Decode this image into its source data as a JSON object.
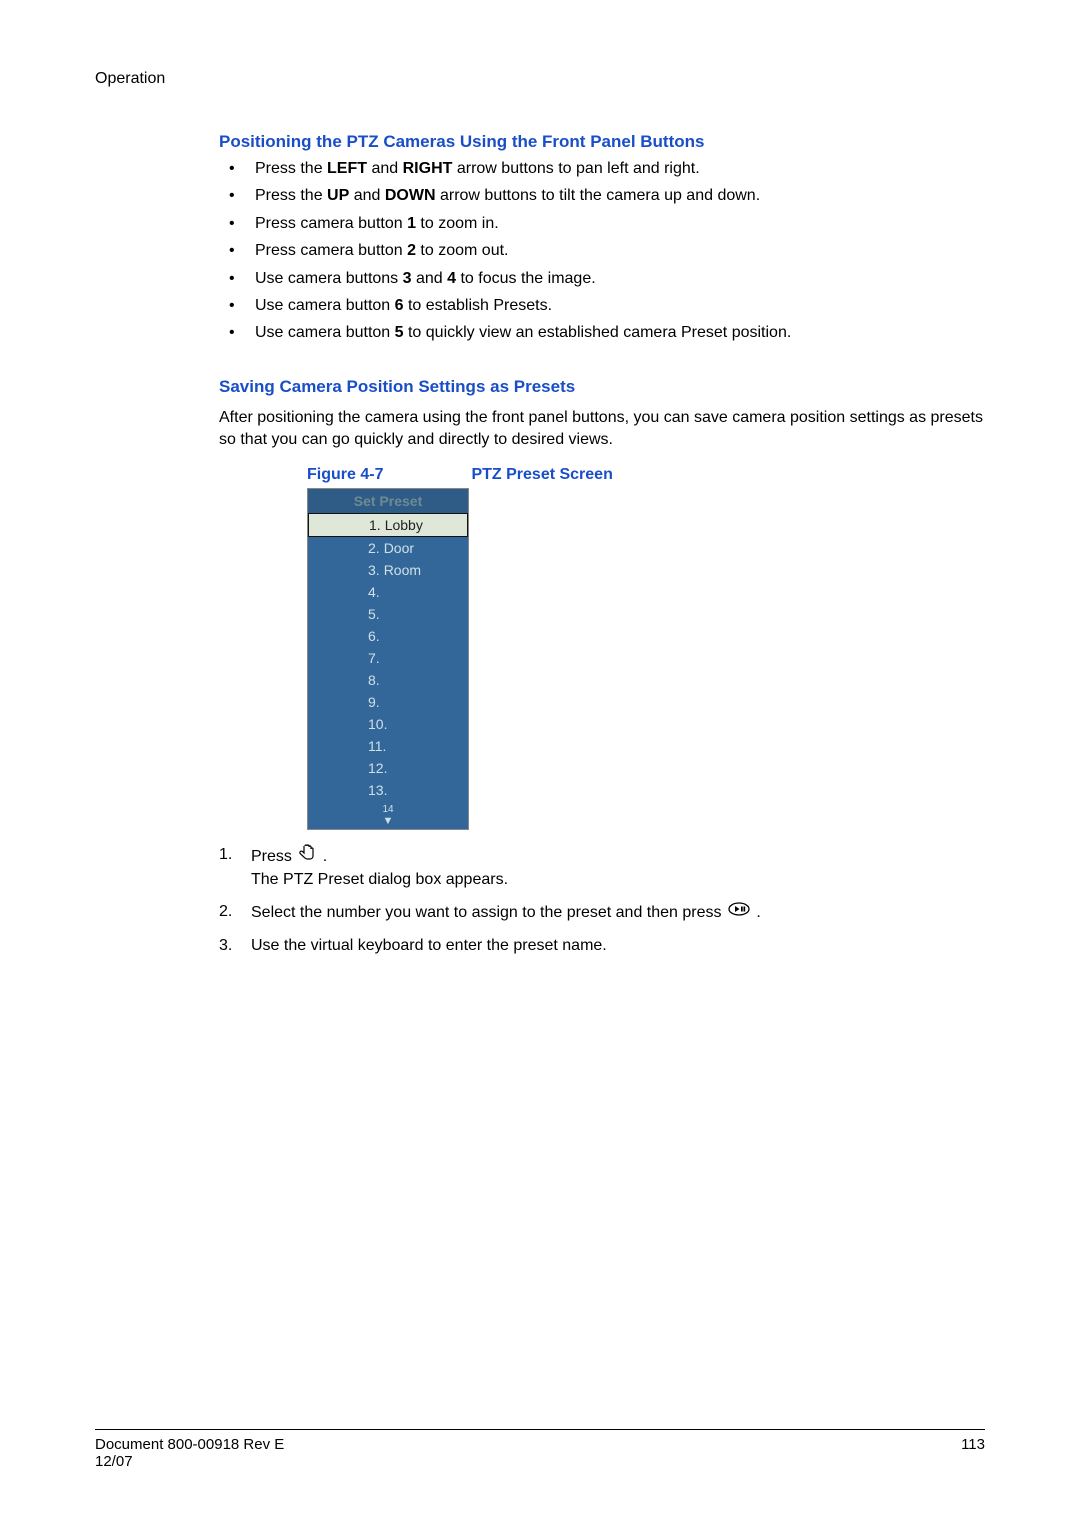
{
  "section_label": "Operation",
  "heading1": "Positioning the PTZ Cameras Using the Front Panel Buttons",
  "bullets": [
    {
      "pre": "Press the ",
      "b1": "LEFT",
      "mid": " and ",
      "b2": "RIGHT",
      "post": " arrow buttons to pan left and right."
    },
    {
      "pre": "Press the ",
      "b1": "UP",
      "mid": " and ",
      "b2": "DOWN",
      "post": " arrow buttons to tilt the camera up and down."
    },
    {
      "pre": "Press camera button ",
      "b1": "1",
      "mid": "",
      "b2": "",
      "post": " to zoom in."
    },
    {
      "pre": "Press camera button ",
      "b1": "2",
      "mid": "",
      "b2": "",
      "post": " to zoom out."
    },
    {
      "pre": "Use camera buttons ",
      "b1": "3",
      "mid": " and ",
      "b2": "4",
      "post": " to focus the image."
    },
    {
      "pre": "Use camera button ",
      "b1": "6",
      "mid": "",
      "b2": "",
      "post": " to establish Presets."
    },
    {
      "pre": "Use camera button ",
      "b1": "5",
      "mid": "",
      "b2": "",
      "post": " to quickly view an established camera Preset position."
    }
  ],
  "heading2": "Saving Camera Position Settings as Presets",
  "para1": "After positioning the camera using the front panel buttons, you can save camera position settings as presets so that you can go quickly and directly to desired views.",
  "figure": {
    "num": "Figure 4-7",
    "title": "PTZ Preset Screen"
  },
  "preset": {
    "title": "Set Preset",
    "items": [
      {
        "n": "1.",
        "label": "Lobby",
        "selected": true
      },
      {
        "n": "2.",
        "label": "Door",
        "selected": false
      },
      {
        "n": "3.",
        "label": "Room",
        "selected": false
      },
      {
        "n": "4.",
        "label": "",
        "selected": false
      },
      {
        "n": "5.",
        "label": "",
        "selected": false
      },
      {
        "n": "6.",
        "label": "",
        "selected": false
      },
      {
        "n": "7.",
        "label": "",
        "selected": false
      },
      {
        "n": "8.",
        "label": "",
        "selected": false
      },
      {
        "n": "9.",
        "label": "",
        "selected": false
      },
      {
        "n": "10.",
        "label": "",
        "selected": false
      },
      {
        "n": "11.",
        "label": "",
        "selected": false
      },
      {
        "n": "12.",
        "label": "",
        "selected": false
      },
      {
        "n": "13.",
        "label": "",
        "selected": false
      }
    ],
    "cutoff": "14",
    "arrow": "▼"
  },
  "steps": {
    "s1": {
      "n": "1.",
      "pre": "Press ",
      "post": ".",
      "line2": "The PTZ Preset dialog box appears."
    },
    "s2": {
      "n": "2.",
      "pre": "Select the number you want to assign to the preset and then press ",
      "post": "."
    },
    "s3": {
      "n": "3.",
      "text": "Use the virtual keyboard to enter the preset name."
    }
  },
  "footer": {
    "left_line1": "Document 800-00918 Rev E",
    "left_line2": "12/07",
    "right": "113"
  }
}
